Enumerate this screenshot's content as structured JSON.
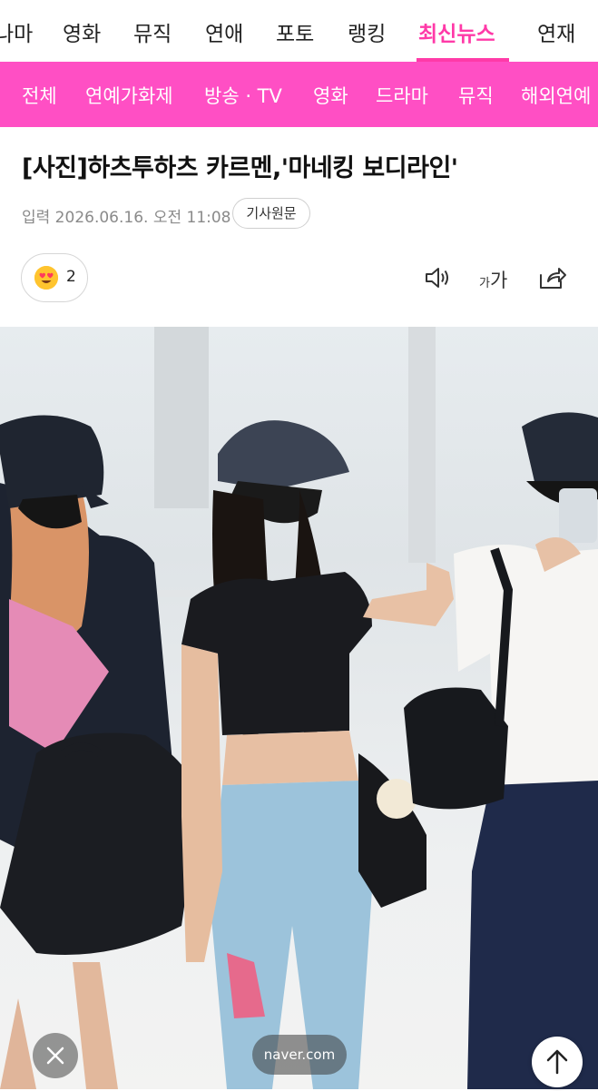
{
  "top_nav": {
    "items": [
      "나마",
      "영화",
      "뮤직",
      "연애",
      "포토",
      "랭킹",
      "최신뉴스",
      "연재"
    ],
    "active_index": 6,
    "active_color": "#ff3aa8"
  },
  "sub_nav": {
    "background": "#ff4fc4",
    "items": [
      "전체",
      "연예가화제",
      "방송 · TV",
      "영화",
      "드라마",
      "뮤직",
      "해외연예"
    ]
  },
  "article": {
    "title": "[사진]하츠투하츠 카르멘,'마네킹 보디라인'",
    "published_label": "입력 2026.06.16. 오전 11:08",
    "source_button": "기사원문",
    "reaction": {
      "icon": "heart-eyes-emoji-icon",
      "count": "2"
    },
    "tools": {
      "tts": "speaker-icon",
      "font_size_small": "가",
      "font_size_big": "가",
      "share": "share-icon"
    }
  },
  "photo": {
    "subject": "airport-fashion-photo"
  },
  "overlay": {
    "close": "close-icon",
    "source_pill": "naver.com",
    "scroll_top": "arrow-up-icon"
  }
}
